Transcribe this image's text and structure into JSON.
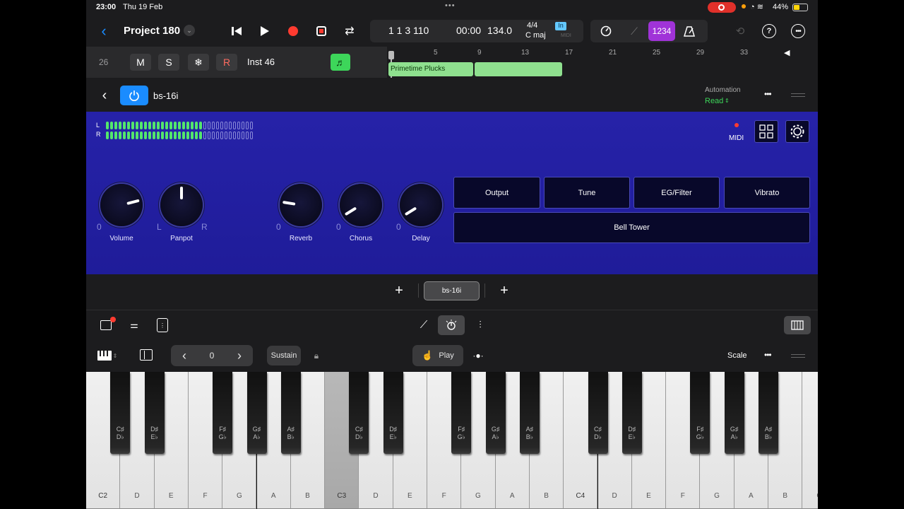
{
  "status": {
    "time": "23:00",
    "date": "Thu 19 Feb",
    "battery": "44%"
  },
  "control": {
    "project_title": "Project 180",
    "position": "1 1 3 110",
    "time": "00:00",
    "tempo": "134.0",
    "signature": "4/4",
    "key": "C maj",
    "in_label": "In",
    "midi_label": "MIDI",
    "count_in": "1234"
  },
  "track": {
    "number": "26",
    "mute": "M",
    "solo": "S",
    "record": "R",
    "name": "Inst 46",
    "ruler": [
      "5",
      "9",
      "13",
      "17",
      "21",
      "25",
      "29",
      "33"
    ],
    "region_name": "Primetime Plucks"
  },
  "plugin": {
    "name": "bs-16i",
    "automation_label": "Automation",
    "automation_mode": "Read",
    "meter_L": "L",
    "meter_R": "R",
    "midi_indicator": "MIDI",
    "knobs": [
      {
        "label": "Volume",
        "min": "0",
        "max": "",
        "value": 0.78
      },
      {
        "label": "Panpot",
        "min": "L",
        "max": "R",
        "value": 0.5
      },
      {
        "label": "Reverb",
        "min": "0",
        "max": "",
        "value": 0.2
      },
      {
        "label": "Chorus",
        "min": "0",
        "max": "",
        "value": 0.05
      },
      {
        "label": "Delay",
        "min": "0",
        "max": "",
        "value": 0.05
      }
    ],
    "buttons": [
      "Output",
      "Tune",
      "EG/Filter",
      "Vibrato"
    ],
    "preset": "Bell Tower",
    "slot_name": "bs-16i"
  },
  "keyboard_bar": {
    "octave": "0",
    "sustain": "Sustain",
    "play": "Play",
    "scale": "Scale"
  },
  "keyboard": {
    "white_labels": [
      "C2",
      "D",
      "E",
      "F",
      "G",
      "A",
      "B",
      "C3",
      "D",
      "E",
      "F",
      "G",
      "A",
      "B",
      "C4",
      "D",
      "E",
      "F",
      "G",
      "A",
      "B",
      "C"
    ],
    "black_labels": [
      "C♯\nD♭",
      "D♯\nE♭",
      "F♯\nG♭",
      "G♯\nA♭",
      "A♯\nB♭",
      "C♯\nD♭",
      "D♯\nE♭",
      "F♯\nG♭",
      "G♯\nA♭",
      "A♯\nB♭",
      "C♯\nD♭",
      "D♯\nE♭",
      "F♯\nG♭",
      "G♯\nA♭",
      "A♯\nB♭"
    ]
  },
  "colors": {
    "accent": "#1a8cff",
    "record": "#ff3b30",
    "region": "#8fe08f",
    "panel": "#2320a6",
    "meter": "#53e66c"
  }
}
